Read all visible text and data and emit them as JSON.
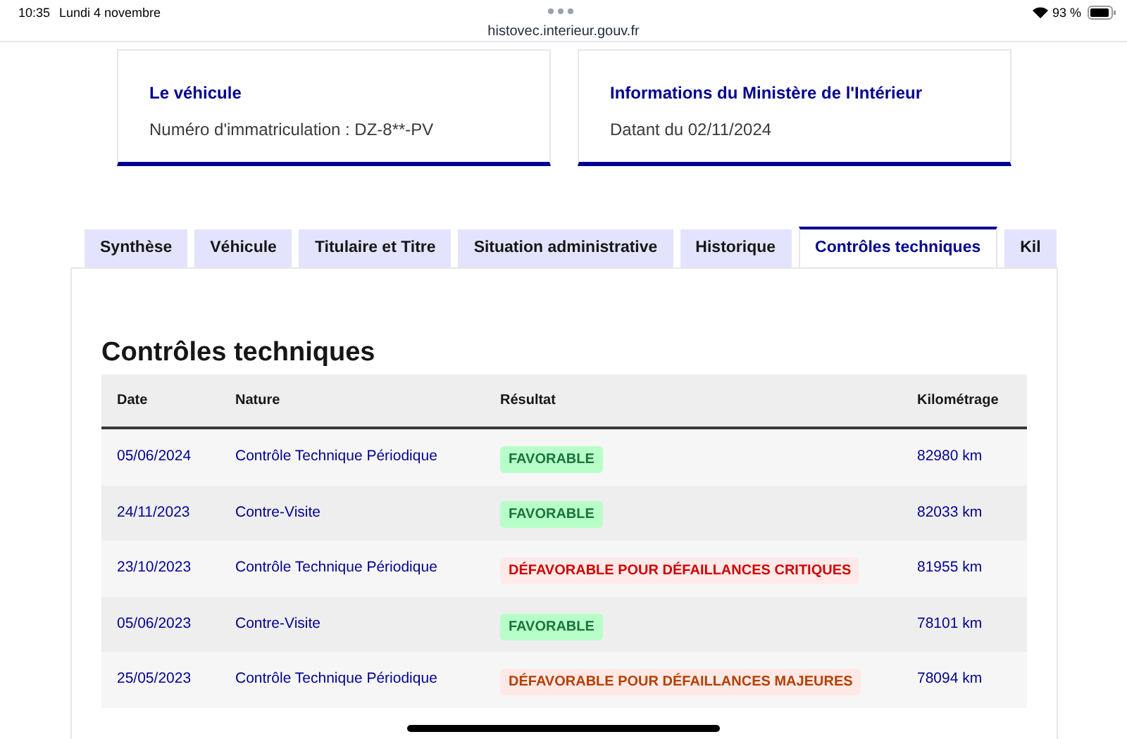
{
  "status_bar": {
    "time": "10:35",
    "date": "Lundi 4 novembre",
    "url": "histovec.interieur.gouv.fr",
    "battery": "93 %"
  },
  "cards": [
    {
      "title": "Le véhicule",
      "text": "Numéro d'immatriculation : DZ-8**-PV"
    },
    {
      "title": "Informations du Ministère de l'Intérieur",
      "text": "Datant du 02/11/2024"
    }
  ],
  "tabs": [
    {
      "label": "Synthèse",
      "selected": false
    },
    {
      "label": "Véhicule",
      "selected": false
    },
    {
      "label": "Titulaire et Titre",
      "selected": false
    },
    {
      "label": "Situation administrative",
      "selected": false
    },
    {
      "label": "Historique",
      "selected": false
    },
    {
      "label": "Contrôles techniques",
      "selected": true
    },
    {
      "label": "Kil",
      "selected": false
    }
  ],
  "section_title": "Contrôles techniques",
  "table": {
    "columns": [
      "Date",
      "Nature",
      "Résultat",
      "Kilométrage"
    ],
    "rows": [
      {
        "date": "05/06/2024",
        "nature": "Contrôle Technique Périodique",
        "result": {
          "text": "FAVORABLE",
          "kind": "favorable"
        },
        "km": "82980 km"
      },
      {
        "date": "24/11/2023",
        "nature": "Contre-Visite",
        "result": {
          "text": "FAVORABLE",
          "kind": "favorable"
        },
        "km": "82033 km"
      },
      {
        "date": "23/10/2023",
        "nature": "Contrôle Technique Périodique",
        "result": {
          "text": "DÉFAVORABLE POUR DÉFAILLANCES CRITIQUES",
          "kind": "critical"
        },
        "km": "81955 km"
      },
      {
        "date": "05/06/2023",
        "nature": "Contre-Visite",
        "result": {
          "text": "FAVORABLE",
          "kind": "favorable"
        },
        "km": "78101 km"
      },
      {
        "date": "25/05/2023",
        "nature": "Contrôle Technique Périodique",
        "result": {
          "text": "DÉFAVORABLE POUR DÉFAILLANCES MAJEURES",
          "kind": "major"
        },
        "km": "78094 km"
      }
    ]
  }
}
